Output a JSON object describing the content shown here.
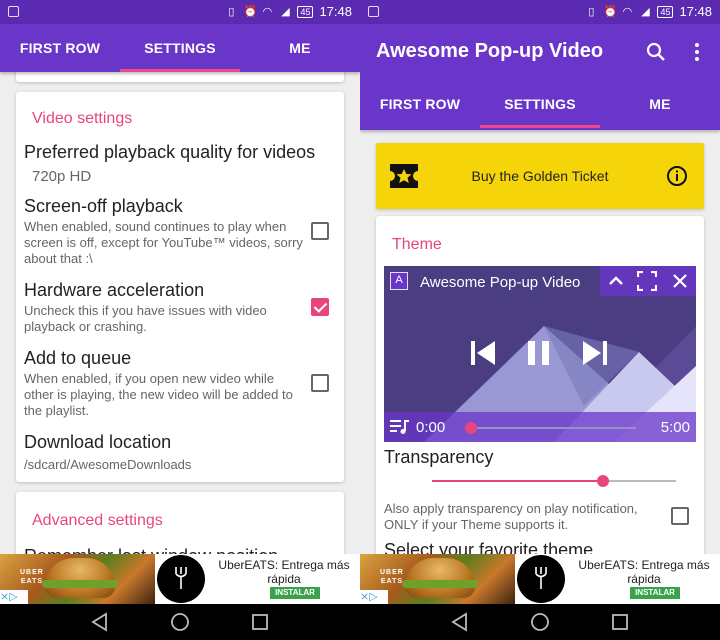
{
  "status_bar": {
    "time": "17:48",
    "battery": "45"
  },
  "left": {
    "tabs": [
      "FIRST ROW",
      "SETTINGS",
      "ME"
    ],
    "video_settings": {
      "title": "Video settings",
      "items": [
        {
          "title": "Preferred playback quality for videos",
          "value": "720p HD"
        },
        {
          "title": "Screen-off playback",
          "desc": "When enabled, sound continues to play when screen is off, except for YouTube™ videos, sorry about that :\\",
          "checked": false
        },
        {
          "title": "Hardware acceleration",
          "desc": "Uncheck this if you have issues with video playback or crashing.",
          "checked": true
        },
        {
          "title": "Add to queue",
          "desc": "When enabled, if you open new video while other is playing, the new video will be added to the playlist.",
          "checked": false
        },
        {
          "title": "Download location",
          "value": "/sdcard/AwesomeDownloads"
        }
      ]
    },
    "advanced_settings": {
      "title": "Advanced settings",
      "first_item_partial": "Remember last window position"
    }
  },
  "right": {
    "app_title": "Awesome Pop-up Video",
    "tabs": [
      "FIRST ROW",
      "SETTINGS",
      "ME"
    ],
    "golden_ticket": "Buy the Golden Ticket",
    "theme": {
      "title": "Theme",
      "player_title": "Awesome Pop-up Video",
      "player_badge": "A",
      "current_time": "0:00",
      "duration": "5:00",
      "progress": 0.0
    },
    "transparency": {
      "label": "Transparency",
      "value": 0.7
    },
    "notif_transparency": {
      "desc": "Also apply transparency on play notification, ONLY if your Theme supports it.",
      "checked": false
    },
    "favorite_theme_partial": "Select your favorite theme"
  },
  "ad": {
    "text": "UberEATS: Entrega más rápida",
    "install": "INSTALAR",
    "brand_top": "UBER",
    "brand_bottom": "EATS"
  },
  "colors": {
    "primary": "#6a35c9",
    "status": "#5a2ab0",
    "accent": "#e8457f",
    "golden": "#f5d50a"
  }
}
